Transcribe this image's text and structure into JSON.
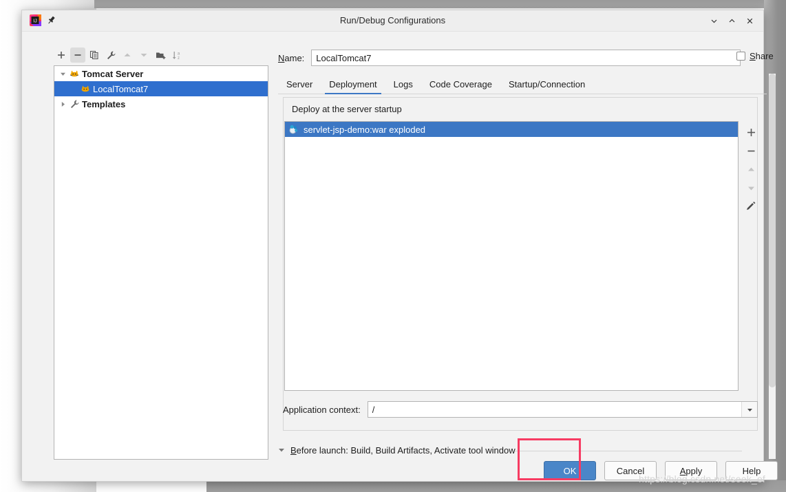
{
  "window": {
    "title": "Run/Debug Configurations",
    "logo_icon": "intellij-idea-logo-icon",
    "pin_icon": "pin-icon",
    "controls": [
      {
        "name": "minimize",
        "glyph": "∨"
      },
      {
        "name": "maximize",
        "glyph": "∧"
      },
      {
        "name": "close",
        "glyph": "✕"
      }
    ]
  },
  "left_toolbar": {
    "buttons": [
      {
        "name": "add-configuration-button",
        "icon": "plus-icon",
        "glyph": "+",
        "state": "normal"
      },
      {
        "name": "remove-configuration-button",
        "icon": "minus-icon",
        "glyph": "−",
        "state": "active"
      },
      {
        "name": "copy-configuration-button",
        "icon": "copy-icon",
        "glyph": "⧉",
        "state": "normal"
      },
      {
        "name": "edit-templates-button",
        "icon": "wrench-icon",
        "glyph": "🔧",
        "state": "normal"
      },
      {
        "name": "move-up-button",
        "icon": "triangle-up-icon",
        "glyph": "▲",
        "state": "disabled"
      },
      {
        "name": "move-down-button",
        "icon": "triangle-down-icon",
        "glyph": "▼",
        "state": "disabled"
      },
      {
        "name": "move-into-folder-button",
        "icon": "folder-add-icon",
        "glyph": "◮",
        "state": "normal"
      },
      {
        "name": "sort-alphabetically-button",
        "icon": "sort-az-icon",
        "glyph": "↓",
        "state": "normal"
      }
    ]
  },
  "tree": {
    "nodes": [
      {
        "label": "Tomcat Server",
        "icon": "tomcat-icon",
        "expanded": true,
        "bold": true,
        "selected": false,
        "indent": 0
      },
      {
        "label": "LocalTomcat7",
        "icon": "tomcat-icon",
        "expanded": null,
        "bold": false,
        "selected": true,
        "indent": 1
      },
      {
        "label": "Templates",
        "icon": "wrench-icon",
        "expanded": false,
        "bold": true,
        "selected": false,
        "indent": 0
      }
    ]
  },
  "name_field": {
    "label": "Name:",
    "label_mnemonic": "N",
    "value": "LocalTomcat7"
  },
  "share": {
    "label": "Share",
    "label_mnemonic": "S",
    "checked": false
  },
  "tabs": [
    {
      "label": "Server",
      "active": false
    },
    {
      "label": "Deployment",
      "active": true
    },
    {
      "label": "Logs",
      "active": false
    },
    {
      "label": "Code Coverage",
      "active": false
    },
    {
      "label": "Startup/Connection",
      "active": false
    }
  ],
  "deployment": {
    "group_label": "Deploy at the server startup",
    "items": [
      {
        "label": "servlet-jsp-demo:war exploded",
        "icon": "artifact-icon",
        "selected": true
      }
    ],
    "side_toolbar": [
      {
        "name": "add-artifact-button",
        "icon": "plus-icon",
        "glyph": "+",
        "state": "normal"
      },
      {
        "name": "remove-artifact-button",
        "icon": "minus-icon",
        "glyph": "−",
        "state": "normal"
      },
      {
        "name": "move-artifact-up-button",
        "icon": "triangle-up-icon",
        "glyph": "▲",
        "state": "disabled"
      },
      {
        "name": "move-artifact-down-button",
        "icon": "triangle-down-icon",
        "glyph": "▼",
        "state": "disabled"
      },
      {
        "name": "edit-artifact-button",
        "icon": "pencil-icon",
        "glyph": "✎",
        "state": "normal"
      }
    ]
  },
  "application_context": {
    "label": "Application context:",
    "value": "/",
    "dropdown_icon": "chevron-down-icon"
  },
  "before_launch": {
    "toggle_icon": "triangle-down-icon",
    "label": "Before launch: Build, Build Artifacts, Activate tool window",
    "label_mnemonic": "B"
  },
  "buttons": [
    {
      "name": "ok-button",
      "label": "OK",
      "primary": true
    },
    {
      "name": "cancel-button",
      "label": "Cancel",
      "primary": false
    },
    {
      "name": "apply-button",
      "label": "Apply",
      "primary": false,
      "mnemonic": "A"
    },
    {
      "name": "help-button",
      "label": "Help",
      "primary": false
    }
  ],
  "annotation": {
    "type": "highlight-rectangle",
    "color": "#f73b62",
    "target": "ok-button"
  },
  "watermark": {
    "text": "https://blog.csdn.net/seek_of"
  },
  "colors": {
    "selection_blue": "#3c77c4",
    "tree_selection_blue": "#2f6fce",
    "primary_button": "#4a86c8",
    "dialog_bg": "#f2f2f2",
    "annotation_red": "#f73b62"
  }
}
